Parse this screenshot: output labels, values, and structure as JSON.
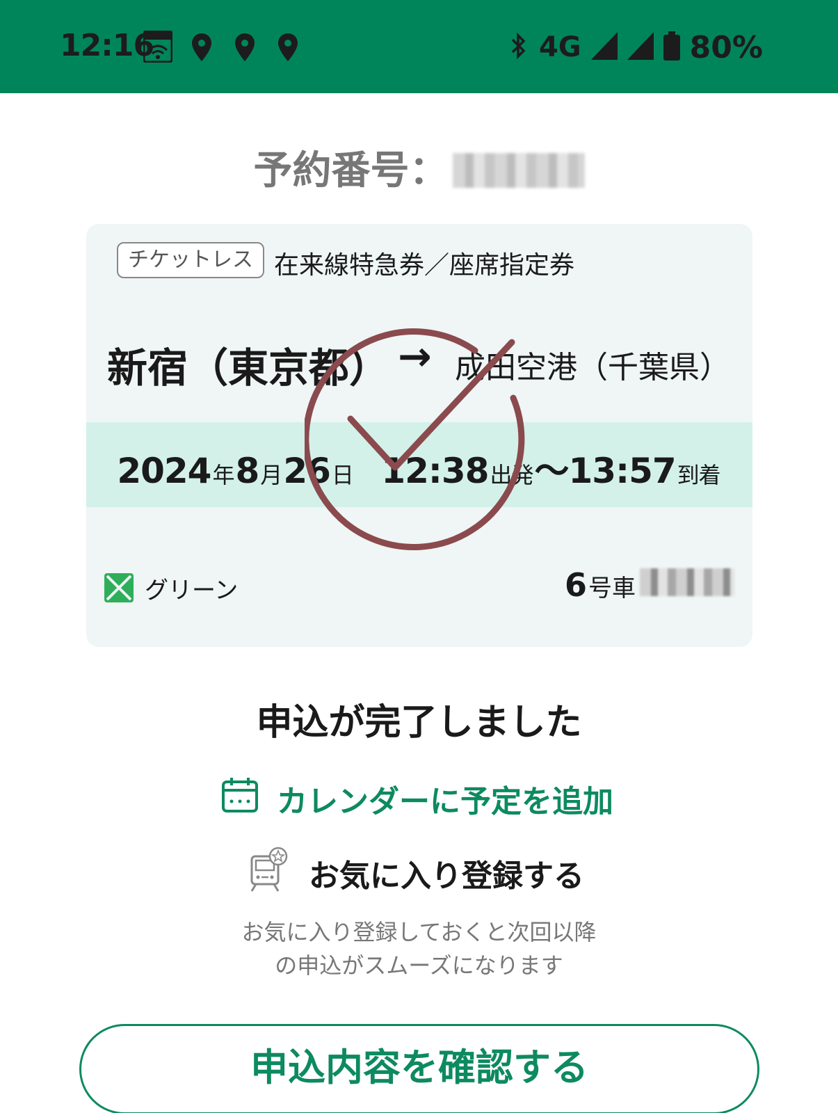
{
  "status_bar": {
    "time": "12:16",
    "network": "4G",
    "battery": "80%",
    "icons": [
      "au-wifi-icon",
      "location-icon",
      "location-icon",
      "location-icon",
      "bluetooth-icon",
      "signal-icon",
      "signal-icon",
      "battery-icon"
    ]
  },
  "reservation": {
    "label": "予約番号："
  },
  "ticket": {
    "badge": "チケットレス",
    "type": "在来線特急券／座席指定券",
    "from": "新宿（東京都）",
    "arrow": "→",
    "to": "成田空港（千葉県）",
    "date": {
      "year": "2024",
      "year_unit": "年",
      "month": "8",
      "month_unit": "月",
      "day": "26",
      "day_unit": "日",
      "depart_time": "12:38",
      "depart_label": "出発",
      "separator": "〜",
      "arrive_time": "13:57",
      "arrive_label": "到着"
    },
    "class_label": "グリーン",
    "car_number": "6",
    "car_unit": "号車"
  },
  "completion": {
    "title": "申込が完了しました",
    "calendar_link": "カレンダーに予定を追加",
    "favorite": "お気に入り登録する",
    "favorite_desc_line1": "お気に入り登録しておくと次回以降",
    "favorite_desc_line2": "の申込がスムーズになります",
    "confirm_button": "申込内容を確認する"
  },
  "colors": {
    "brand_green": "#00855a",
    "accent_green": "#0d8a60",
    "date_band": "#d3f1e9",
    "card_bg": "#eff6f5",
    "stamp": "#8a4a4e"
  }
}
